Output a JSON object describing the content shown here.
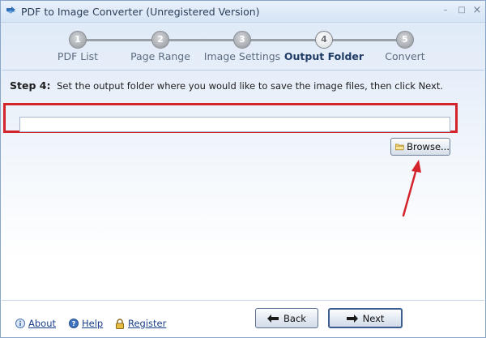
{
  "window": {
    "title": "PDF to Image Converter (Unregistered Version)",
    "controls": {
      "minimize": "–",
      "maximize": "□",
      "close": "×"
    }
  },
  "steps": [
    {
      "number": "1",
      "label": "PDF List",
      "active": false
    },
    {
      "number": "2",
      "label": "Page Range",
      "active": false
    },
    {
      "number": "3",
      "label": "Image Settings",
      "active": false
    },
    {
      "number": "4",
      "label": "Output Folder",
      "active": true
    },
    {
      "number": "5",
      "label": "Convert",
      "active": false
    }
  ],
  "instruction": {
    "step_title": "Step 4:",
    "text": "Set the output folder where you would like to save the image files, then click Next."
  },
  "output_folder": {
    "value": "",
    "placeholder": ""
  },
  "browse_button": {
    "label": "Browse..."
  },
  "footer": {
    "about": "About",
    "help": "Help",
    "register": "Register",
    "back": "Back",
    "next": "Next"
  },
  "colors": {
    "highlight": "#d4242b",
    "link": "#1a3f8a",
    "active_step": "#1f3c66"
  }
}
